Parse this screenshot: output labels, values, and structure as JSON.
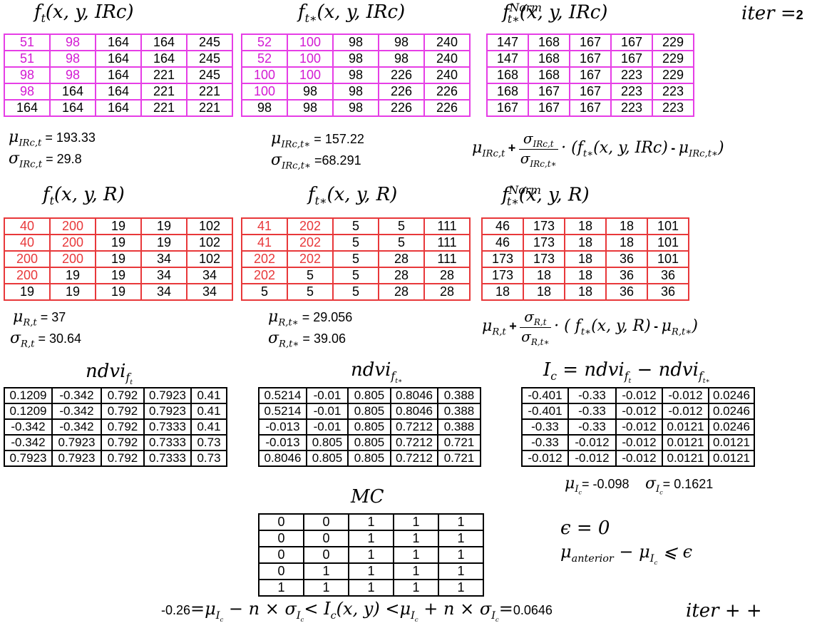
{
  "iter": "2",
  "irc": {
    "titles": {
      "ft": "f",
      "ftstar": "f",
      "fnorm": "f"
    },
    "ft": {
      "rows": [
        [
          "51",
          "98",
          "164",
          "164",
          "245"
        ],
        [
          "51",
          "98",
          "164",
          "164",
          "245"
        ],
        [
          "98",
          "98",
          "164",
          "221",
          "245"
        ],
        [
          "98",
          "164",
          "164",
          "221",
          "221"
        ],
        [
          "164",
          "164",
          "164",
          "221",
          "221"
        ]
      ],
      "highlight": [
        [
          1,
          1,
          0,
          0,
          0
        ],
        [
          1,
          1,
          0,
          0,
          0
        ],
        [
          1,
          1,
          0,
          0,
          0
        ],
        [
          1,
          0,
          0,
          0,
          0
        ],
        [
          0,
          0,
          0,
          0,
          0
        ]
      ]
    },
    "ftstar": {
      "rows": [
        [
          "52",
          "100",
          "98",
          "98",
          "240"
        ],
        [
          "52",
          "100",
          "98",
          "98",
          "240"
        ],
        [
          "100",
          "100",
          "98",
          "226",
          "240"
        ],
        [
          "100",
          "98",
          "98",
          "226",
          "226"
        ],
        [
          "98",
          "98",
          "98",
          "226",
          "226"
        ]
      ],
      "highlight": [
        [
          1,
          1,
          0,
          0,
          0
        ],
        [
          1,
          1,
          0,
          0,
          0
        ],
        [
          1,
          1,
          0,
          0,
          0
        ],
        [
          1,
          0,
          0,
          0,
          0
        ],
        [
          0,
          0,
          0,
          0,
          0
        ]
      ]
    },
    "fnorm": {
      "rows": [
        [
          "147",
          "168",
          "167",
          "167",
          "229"
        ],
        [
          "147",
          "168",
          "167",
          "167",
          "229"
        ],
        [
          "168",
          "168",
          "167",
          "223",
          "229"
        ],
        [
          "168",
          "167",
          "167",
          "223",
          "223"
        ],
        [
          "167",
          "167",
          "167",
          "223",
          "223"
        ]
      ]
    },
    "mu_t": "193.33",
    "sigma_t": "29.8",
    "mu_tstar": "157.22",
    "sigma_tstar": "68.291"
  },
  "r": {
    "ft": {
      "rows": [
        [
          "40",
          "200",
          "19",
          "19",
          "102"
        ],
        [
          "40",
          "200",
          "19",
          "19",
          "102"
        ],
        [
          "200",
          "200",
          "19",
          "34",
          "102"
        ],
        [
          "200",
          "19",
          "19",
          "34",
          "34"
        ],
        [
          "19",
          "19",
          "19",
          "34",
          "34"
        ]
      ],
      "highlight": [
        [
          1,
          1,
          0,
          0,
          0
        ],
        [
          1,
          1,
          0,
          0,
          0
        ],
        [
          1,
          1,
          0,
          0,
          0
        ],
        [
          1,
          0,
          0,
          0,
          0
        ],
        [
          0,
          0,
          0,
          0,
          0
        ]
      ]
    },
    "ftstar": {
      "rows": [
        [
          "41",
          "202",
          "5",
          "5",
          "111"
        ],
        [
          "41",
          "202",
          "5",
          "5",
          "111"
        ],
        [
          "202",
          "202",
          "5",
          "28",
          "111"
        ],
        [
          "202",
          "5",
          "5",
          "28",
          "28"
        ],
        [
          "5",
          "5",
          "5",
          "28",
          "28"
        ]
      ],
      "highlight": [
        [
          1,
          1,
          0,
          0,
          0
        ],
        [
          1,
          1,
          0,
          0,
          0
        ],
        [
          1,
          1,
          0,
          0,
          0
        ],
        [
          1,
          0,
          0,
          0,
          0
        ],
        [
          0,
          0,
          0,
          0,
          0
        ]
      ]
    },
    "fnorm": {
      "rows": [
        [
          "46",
          "173",
          "18",
          "18",
          "101"
        ],
        [
          "46",
          "173",
          "18",
          "18",
          "101"
        ],
        [
          "173",
          "173",
          "18",
          "36",
          "101"
        ],
        [
          "173",
          "18",
          "18",
          "36",
          "36"
        ],
        [
          "18",
          "18",
          "18",
          "36",
          "36"
        ]
      ]
    },
    "mu_t": "37",
    "sigma_t": "30.64",
    "mu_tstar": "29.056",
    "sigma_tstar": "39.06"
  },
  "ndvi": {
    "ft": {
      "rows": [
        [
          "0.1209",
          "-0.342",
          "0.792",
          "0.7923",
          "0.41"
        ],
        [
          "0.1209",
          "-0.342",
          "0.792",
          "0.7923",
          "0.41"
        ],
        [
          "-0.342",
          "-0.342",
          "0.792",
          "0.7333",
          "0.41"
        ],
        [
          "-0.342",
          "0.7923",
          "0.792",
          "0.7333",
          "0.73"
        ],
        [
          "0.7923",
          "0.7923",
          "0.792",
          "0.7333",
          "0.73"
        ]
      ]
    },
    "ftstar": {
      "rows": [
        [
          "0.5214",
          "-0.01",
          "0.805",
          "0.8046",
          "0.388"
        ],
        [
          "0.5214",
          "-0.01",
          "0.805",
          "0.8046",
          "0.388"
        ],
        [
          "-0.013",
          "-0.01",
          "0.805",
          "0.7212",
          "0.388"
        ],
        [
          "-0.013",
          "0.805",
          "0.805",
          "0.7212",
          "0.721"
        ],
        [
          "0.8046",
          "0.805",
          "0.805",
          "0.7212",
          "0.721"
        ]
      ]
    },
    "ic": {
      "rows": [
        [
          "-0.401",
          "-0.33",
          "-0.012",
          "-0.012",
          "0.0246"
        ],
        [
          "-0.401",
          "-0.33",
          "-0.012",
          "-0.012",
          "0.0246"
        ],
        [
          "-0.33",
          "-0.33",
          "-0.012",
          "0.0121",
          "0.0246"
        ],
        [
          "-0.33",
          "-0.012",
          "-0.012",
          "0.0121",
          "0.0121"
        ],
        [
          "-0.012",
          "-0.012",
          "-0.012",
          "0.0121",
          "0.0121"
        ]
      ]
    },
    "mu_ic": "-0.098",
    "sigma_ic": "0.1621"
  },
  "mc": {
    "rows": [
      [
        "0",
        "0",
        "1",
        "1",
        "1"
      ],
      [
        "0",
        "0",
        "1",
        "1",
        "1"
      ],
      [
        "0",
        "0",
        "1",
        "1",
        "1"
      ],
      [
        "0",
        "1",
        "1",
        "1",
        "1"
      ],
      [
        "1",
        "1",
        "1",
        "1",
        "1"
      ]
    ]
  },
  "epsilon": "0",
  "lower_bound": "-0.26",
  "upper_bound": "0.0646",
  "colors": {
    "irc_border": "#e63ee6",
    "irc_text": "#d31ad3",
    "r_border": "#e8383a",
    "r_text": "#e8383a",
    "black": "#000000"
  }
}
